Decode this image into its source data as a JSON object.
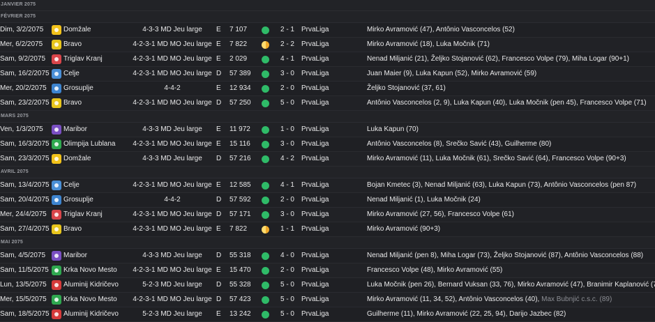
{
  "months": [
    {
      "label": "JANVIER 2075",
      "matches": []
    },
    {
      "label": "FÉVRIER 2075",
      "matches": [
        {
          "date": "Dim, 3/2/2075",
          "opponent": "Domžale",
          "crest_color": "#f2c21a",
          "formation": "4-3-3 MD Jeu large",
          "venue": "E",
          "attendance": "7 107",
          "result_type": "win",
          "score": "2 - 1",
          "competition": "PrvaLiga",
          "scorers": "Mirko Avramović (47), Antônio Vasconcelos (52)",
          "scorers_extra": ""
        },
        {
          "date": "Mer, 6/2/2075",
          "opponent": "Bravo",
          "crest_color": "#e8c51c",
          "formation": "4-2-3-1 MD MO Jeu large",
          "venue": "E",
          "attendance": "7 822",
          "result_type": "draw",
          "score": "2 - 2",
          "competition": "PrvaLiga",
          "scorers": "Mirko Avramović (18), Luka Močnik (71)",
          "scorers_extra": ""
        },
        {
          "date": "Sam, 9/2/2075",
          "opponent": "Triglav Kranj",
          "crest_color": "#d9454a",
          "formation": "4-2-3-1 MD MO Jeu large",
          "venue": "E",
          "attendance": "2 029",
          "result_type": "win",
          "score": "4 - 1",
          "competition": "PrvaLiga",
          "scorers": "Nenad Miljanić (21), Željko Stojanović (62), Francesco Volpe (79), Miha Logar (90+1)",
          "scorers_extra": ""
        },
        {
          "date": "Sam, 16/2/2075",
          "opponent": "Celje",
          "crest_color": "#4a8fd6",
          "formation": "4-2-3-1 MD MO Jeu large",
          "venue": "D",
          "attendance": "57 389",
          "result_type": "win",
          "score": "3 - 0",
          "competition": "PrvaLiga",
          "scorers": "Juan Maier (9), Luka Kapun (52), Mirko Avramović (59)",
          "scorers_extra": ""
        },
        {
          "date": "Mer, 20/2/2075",
          "opponent": "Grosuplje",
          "crest_color": "#3d84cf",
          "formation": "4-4-2",
          "venue": "E",
          "attendance": "12 934",
          "result_type": "win",
          "score": "2 - 0",
          "competition": "PrvaLiga",
          "scorers": "Željko Stojanović (37, 61)",
          "scorers_extra": ""
        },
        {
          "date": "Sam, 23/2/2075",
          "opponent": "Bravo",
          "crest_color": "#e8c51c",
          "formation": "4-2-3-1 MD MO Jeu large",
          "venue": "D",
          "attendance": "57 250",
          "result_type": "win",
          "score": "5 - 0",
          "competition": "PrvaLiga",
          "scorers": "Antônio Vasconcelos (2, 9), Luka Kapun (40), Luka Močnik (pen 45), Francesco Volpe (71)",
          "scorers_extra": ""
        }
      ]
    },
    {
      "label": "MARS 2075",
      "matches": [
        {
          "date": "Ven, 1/3/2075",
          "opponent": "Maribor",
          "crest_color": "#7a4fc2",
          "formation": "4-3-3 MD Jeu large",
          "venue": "E",
          "attendance": "11 972",
          "result_type": "win",
          "score": "1 - 0",
          "competition": "PrvaLiga",
          "scorers": "Luka Kapun (70)",
          "scorers_extra": ""
        },
        {
          "date": "Sam, 16/3/2075",
          "opponent": "Olimpija Lublana",
          "crest_color": "#2fa84f",
          "formation": "4-2-3-1 MD MO Jeu large",
          "venue": "E",
          "attendance": "15 116",
          "result_type": "win",
          "score": "3 - 0",
          "competition": "PrvaLiga",
          "scorers": "Antônio Vasconcelos (8), Srečko Savić (43), Guilherme (80)",
          "scorers_extra": ""
        },
        {
          "date": "Sam, 23/3/2075",
          "opponent": "Domžale",
          "crest_color": "#f2c21a",
          "formation": "4-3-3 MD Jeu large",
          "venue": "D",
          "attendance": "57 216",
          "result_type": "win",
          "score": "4 - 2",
          "competition": "PrvaLiga",
          "scorers": "Mirko Avramović (11), Luka Močnik (61), Srečko Savić (64), Francesco Volpe (90+3)",
          "scorers_extra": ""
        }
      ]
    },
    {
      "label": "AVRIL 2075",
      "matches": [
        {
          "date": "Sam, 13/4/2075",
          "opponent": "Celje",
          "crest_color": "#4a8fd6",
          "formation": "4-2-3-1 MD MO Jeu large",
          "venue": "E",
          "attendance": "12 585",
          "result_type": "win",
          "score": "4 - 1",
          "competition": "PrvaLiga",
          "scorers": "Bojan Kmetec (3), Nenad Miljanić (63), Luka Kapun (73), Antônio Vasconcelos (pen 87)",
          "scorers_extra": ""
        },
        {
          "date": "Sam, 20/4/2075",
          "opponent": "Grosuplje",
          "crest_color": "#3d84cf",
          "formation": "4-4-2",
          "venue": "D",
          "attendance": "57 592",
          "result_type": "win",
          "score": "2 - 0",
          "competition": "PrvaLiga",
          "scorers": "Nenad Miljanić (1), Luka Močnik (24)",
          "scorers_extra": ""
        },
        {
          "date": "Mer, 24/4/2075",
          "opponent": "Triglav Kranj",
          "crest_color": "#d9454a",
          "formation": "4-2-3-1 MD MO Jeu large",
          "venue": "D",
          "attendance": "57 171",
          "result_type": "win",
          "score": "3 - 0",
          "competition": "PrvaLiga",
          "scorers": "Mirko Avramović (27, 56), Francesco Volpe (61)",
          "scorers_extra": ""
        },
        {
          "date": "Sam, 27/4/2075",
          "opponent": "Bravo",
          "crest_color": "#e8c51c",
          "formation": "4-2-3-1 MD MO Jeu large",
          "venue": "E",
          "attendance": "7 822",
          "result_type": "draw",
          "score": "1 - 1",
          "competition": "PrvaLiga",
          "scorers": "Mirko Avramović (90+3)",
          "scorers_extra": ""
        }
      ]
    },
    {
      "label": "MAI 2075",
      "matches": [
        {
          "date": "Sam, 4/5/2075",
          "opponent": "Maribor",
          "crest_color": "#7a4fc2",
          "formation": "4-3-3 MD Jeu large",
          "venue": "D",
          "attendance": "55 318",
          "result_type": "win",
          "score": "4 - 0",
          "competition": "PrvaLiga",
          "scorers": "Nenad Miljanić (pen 8), Miha Logar (73), Željko Stojanović (87), Antônio Vasconcelos (88)",
          "scorers_extra": ""
        },
        {
          "date": "Sam, 11/5/2075",
          "opponent": "Krka Novo Mesto",
          "crest_color": "#2fa84f",
          "formation": "4-2-3-1 MD MO Jeu large",
          "venue": "E",
          "attendance": "15 470",
          "result_type": "win",
          "score": "2 - 0",
          "competition": "PrvaLiga",
          "scorers": "Francesco Volpe (48), Mirko Avramović (55)",
          "scorers_extra": ""
        },
        {
          "date": "Lun, 13/5/2075",
          "opponent": "Aluminij Kidričevo",
          "crest_color": "#d63a3a",
          "formation": "5-2-3 MD Jeu large",
          "venue": "D",
          "attendance": "55 328",
          "result_type": "win",
          "score": "5 - 0",
          "competition": "PrvaLiga",
          "scorers": "Luka Močnik (pen 26), Bernard Vuksan (33, 76), Mirko Avramović (47), Branimir Kaplanović (70)",
          "scorers_extra": ""
        },
        {
          "date": "Mer, 15/5/2075",
          "opponent": "Krka Novo Mesto",
          "crest_color": "#2fa84f",
          "formation": "4-2-3-1 MD MO Jeu large",
          "venue": "D",
          "attendance": "57 423",
          "result_type": "win",
          "score": "5 - 0",
          "competition": "PrvaLiga",
          "scorers": "Mirko Avramović (11, 34, 52), Antônio Vasconcelos (40),",
          "scorers_extra": "Max Bubnjić c.s.c. (89)"
        },
        {
          "date": "Sam, 18/5/2075",
          "opponent": "Aluminij Kidričevo",
          "crest_color": "#d63a3a",
          "formation": "5-2-3 MD Jeu large",
          "venue": "E",
          "attendance": "13 242",
          "result_type": "win",
          "score": "5 - 0",
          "competition": "PrvaLiga",
          "scorers": "Guilherme (11), Mirko Avramović (22, 25, 94), Darijo Jazbec (82)",
          "scorers_extra": ""
        }
      ]
    }
  ],
  "icons": {
    "crest": "club-crest-icon",
    "result_win": "win-dot-icon",
    "result_draw": "draw-dot-icon"
  },
  "colors": {
    "win": "#2fbb68",
    "draw": "#f0a92a",
    "background": "#1f2024"
  }
}
